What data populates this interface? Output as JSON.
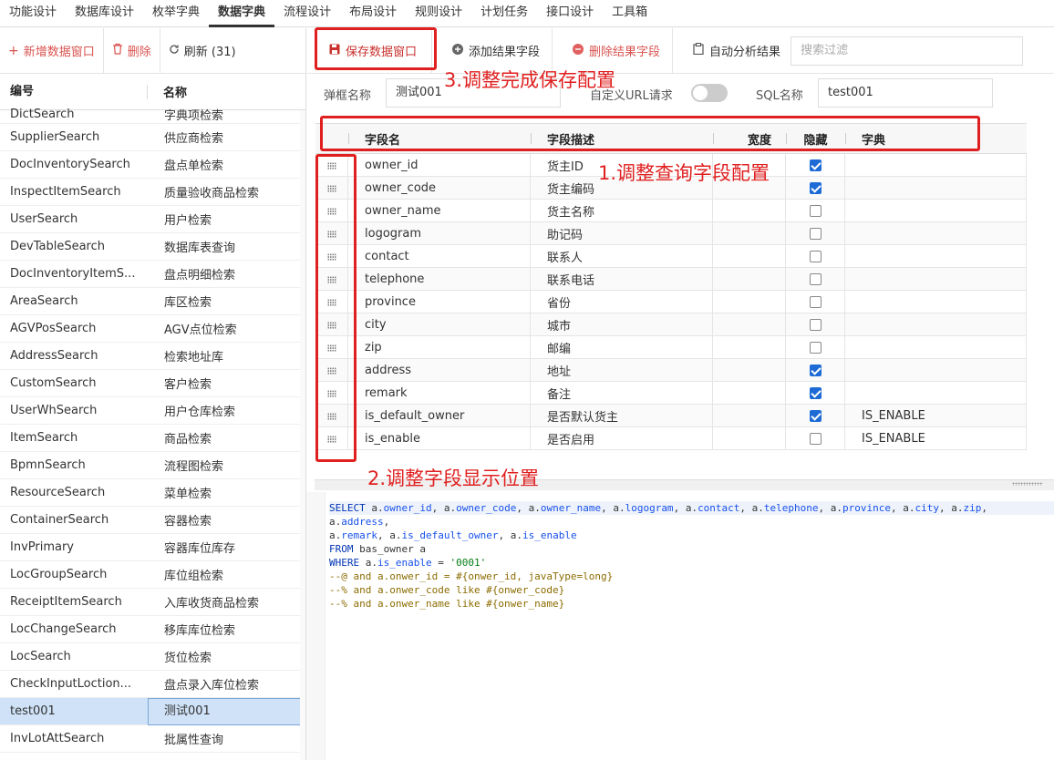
{
  "topnav": {
    "tabs": [
      {
        "label": "功能设计"
      },
      {
        "label": "数据库设计"
      },
      {
        "label": "枚举字典"
      },
      {
        "label": "数据字典",
        "active": true
      },
      {
        "label": "流程设计"
      },
      {
        "label": "布局设计"
      },
      {
        "label": "规则设计"
      },
      {
        "label": "计划任务"
      },
      {
        "label": "接口设计"
      },
      {
        "label": "工具箱"
      }
    ]
  },
  "left_toolbar": {
    "add_label": "新增数据窗口",
    "delete_label": "删除",
    "refresh_label": "刷新 (31)"
  },
  "left_table": {
    "col_code": "编号",
    "col_name": "名称",
    "rows": [
      {
        "code": "DictSearch",
        "name": "字典项检索"
      },
      {
        "code": "SupplierSearch",
        "name": "供应商检索"
      },
      {
        "code": "DocInventorySearch",
        "name": "盘点单检索"
      },
      {
        "code": "InspectItemSearch",
        "name": "质量验收商品检索"
      },
      {
        "code": "UserSearch",
        "name": "用户检索"
      },
      {
        "code": "DevTableSearch",
        "name": "数据库表查询"
      },
      {
        "code": "DocInventoryItemS...",
        "name": "盘点明细检索"
      },
      {
        "code": "AreaSearch",
        "name": "库区检索"
      },
      {
        "code": "AGVPosSearch",
        "name": "AGV点位检索"
      },
      {
        "code": "AddressSearch",
        "name": "检索地址库"
      },
      {
        "code": "CustomSearch",
        "name": "客户检索"
      },
      {
        "code": "UserWhSearch",
        "name": "用户仓库检索"
      },
      {
        "code": "ItemSearch",
        "name": "商品检索"
      },
      {
        "code": "BpmnSearch",
        "name": "流程图检索"
      },
      {
        "code": "ResourceSearch",
        "name": "菜单检索"
      },
      {
        "code": "ContainerSearch",
        "name": "容器检索"
      },
      {
        "code": "InvPrimary",
        "name": "容器库位库存"
      },
      {
        "code": "LocGroupSearch",
        "name": "库位组检索"
      },
      {
        "code": "ReceiptItemSearch",
        "name": "入库收货商品检索"
      },
      {
        "code": "LocChangeSearch",
        "name": "移库库位检索"
      },
      {
        "code": "LocSearch",
        "name": "货位检索"
      },
      {
        "code": "CheckInputLoction...",
        "name": "盘点录入库位检索"
      },
      {
        "code": "test001",
        "name": "测试001",
        "selected": true
      },
      {
        "code": "InvLotAttSearch",
        "name": "批属性查询"
      }
    ]
  },
  "right_toolbar": {
    "save_label": "保存数据窗口",
    "add_field_label": "添加结果字段",
    "remove_field_label": "删除结果字段",
    "auto_analyze_label": "自动分析结果",
    "search_placeholder": "搜索过滤"
  },
  "form": {
    "dialog_name_label": "弹框名称",
    "dialog_name_value": "测试001",
    "custom_url_label": "自定义URL请求",
    "custom_url_enabled": false,
    "sql_name_label": "SQL名称",
    "sql_name_value": "test001"
  },
  "grid": {
    "headers": {
      "field": "字段名",
      "desc": "字段描述",
      "width": "宽度",
      "hidden": "隐藏",
      "dict": "字典"
    },
    "rows": [
      {
        "field": "owner_id",
        "desc": "货主ID",
        "width": "",
        "hidden": true,
        "dict": ""
      },
      {
        "field": "owner_code",
        "desc": "货主编码",
        "width": "",
        "hidden": true,
        "dict": ""
      },
      {
        "field": "owner_name",
        "desc": "货主名称",
        "width": "",
        "hidden": false,
        "dict": ""
      },
      {
        "field": "logogram",
        "desc": "助记码",
        "width": "",
        "hidden": false,
        "dict": ""
      },
      {
        "field": "contact",
        "desc": "联系人",
        "width": "",
        "hidden": false,
        "dict": ""
      },
      {
        "field": "telephone",
        "desc": "联系电话",
        "width": "",
        "hidden": false,
        "dict": ""
      },
      {
        "field": "province",
        "desc": "省份",
        "width": "",
        "hidden": false,
        "dict": ""
      },
      {
        "field": "city",
        "desc": "城市",
        "width": "",
        "hidden": false,
        "dict": ""
      },
      {
        "field": "zip",
        "desc": "邮编",
        "width": "",
        "hidden": false,
        "dict": ""
      },
      {
        "field": "address",
        "desc": "地址",
        "width": "",
        "hidden": true,
        "dict": ""
      },
      {
        "field": "remark",
        "desc": "备注",
        "width": "",
        "hidden": true,
        "dict": ""
      },
      {
        "field": "is_default_owner",
        "desc": "是否默认货主",
        "width": "",
        "hidden": true,
        "dict": "IS_ENABLE"
      },
      {
        "field": "is_enable",
        "desc": "是否启用",
        "width": "",
        "hidden": false,
        "dict": "IS_ENABLE"
      }
    ]
  },
  "sql": {
    "lines": [
      "SELECT a.owner_id, a.owner_code, a.owner_name, a.logogram, a.contact, a.telephone, a.province, a.city, a.zip,",
      "a.address,",
      "a.remark, a.is_default_owner, a.is_enable",
      "FROM bas_owner a",
      "WHERE a.is_enable = '0001'",
      "--@ and a.onwer_id = #{onwer_id, javaType=long}",
      "--% and a.onwer_code like #{onwer_code}",
      "--% and a.onwer_name like #{onwer_name}"
    ]
  },
  "annotations": {
    "note_save": "3.调整完成保存配置",
    "note_query": "1.调整查询字段配置",
    "note_position": "2.调整字段显示位置",
    "color": "#e02020"
  }
}
